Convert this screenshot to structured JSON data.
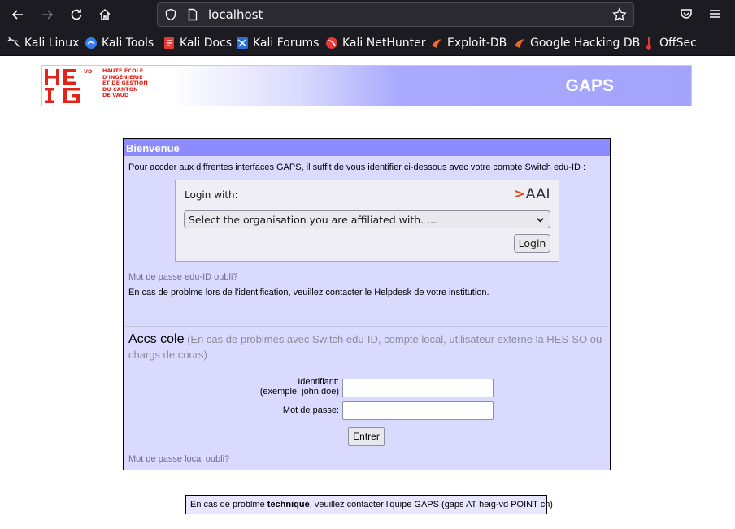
{
  "browser": {
    "url": "localhost",
    "bookmarks": [
      {
        "label": "Kali Linux",
        "icon": "kali-dragon-icon"
      },
      {
        "label": "Kali Tools",
        "icon": "kali-tools-icon"
      },
      {
        "label": "Kali Docs",
        "icon": "kali-docs-icon"
      },
      {
        "label": "Kali Forums",
        "icon": "kali-forums-icon"
      },
      {
        "label": "Kali NetHunter",
        "icon": "kali-nethunter-icon"
      },
      {
        "label": "Exploit-DB",
        "icon": "exploit-db-icon"
      },
      {
        "label": "Google Hacking DB",
        "icon": "ghdb-icon"
      },
      {
        "label": "OffSec",
        "icon": "offsec-icon"
      }
    ]
  },
  "banner": {
    "logo_letters": "HEIG",
    "logo_vd": "VD",
    "logo_lines": [
      "HAUTE ÉCOLE",
      "D'INGÉNIERIE",
      "ET DE GESTION",
      "DU CANTON",
      "DE VAUD"
    ],
    "title": "GAPS"
  },
  "panel": {
    "header": "Bienvenue",
    "intro": "Pour accder aux diffrentes interfaces GAPS, il suffit de vous identifier ci-dessous avec votre compte Switch edu-ID :",
    "login_box": {
      "login_with": "Login with:",
      "aai_logo_text": "AAI",
      "org_select_value": "Select the organisation you are affiliated with. ...",
      "login_button": "Login"
    },
    "forgot_eduid": "Mot de passe edu-ID oubli?",
    "help": "En cas de problme lors de l'identification, veuillez contacter le Helpdesk de votre institution.",
    "ecole_title": "Accs cole",
    "ecole_subtitle": "(En cas de problmes avec Switch edu-ID, compte local, utilisateur externe la HES-SO ou chargs de cours)",
    "identifiant_label": "Identifiant:",
    "identifiant_example": "(exemple: john.doe)",
    "password_label": "Mot de passe:",
    "identifiant_value": "",
    "password_value": "",
    "submit_button": "Entrer",
    "forgot_local": "Mot de passe local oubli?"
  },
  "footer": {
    "before": "En cas de problme ",
    "bold": "technique",
    "after": ", veuillez contacter l'quipe GAPS (gaps AT heig-vd POINT ch)"
  },
  "colors": {
    "panel_header": "#8c8cff",
    "panel_bg": "#dadaff",
    "logo_red": "#e2231a",
    "browser_chrome": "#1c1b22"
  }
}
